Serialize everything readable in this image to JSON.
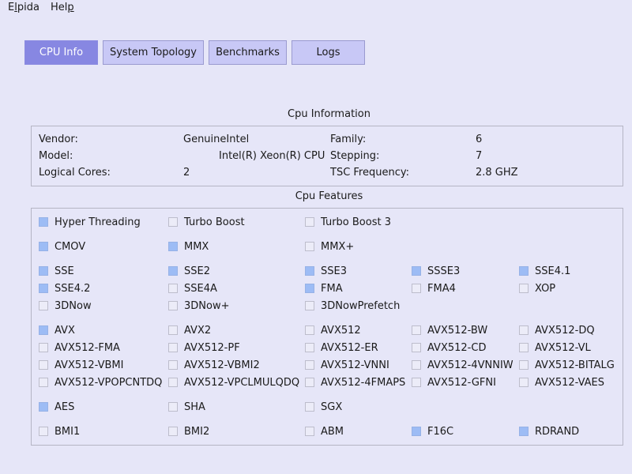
{
  "menu": {
    "app": {
      "before": "E",
      "mnemonic": "l",
      "after": "pida"
    },
    "help": {
      "before": "Hel",
      "mnemonic": "p",
      "after": ""
    }
  },
  "tabs": [
    {
      "label": "CPU Info",
      "active": true
    },
    {
      "label": "System Topology",
      "active": false
    },
    {
      "label": "Benchmarks",
      "active": false
    },
    {
      "label": "Logs",
      "active": false
    }
  ],
  "cpu_info": {
    "title": "Cpu Information",
    "vendor_label": "Vendor:",
    "vendor_value": "GenuineIntel",
    "model_label": "Model:",
    "model_value": "Intel(R) Xeon(R) CPU",
    "logical_cores_label": "Logical Cores:",
    "logical_cores_value": "2",
    "family_label": "Family:",
    "family_value": "6",
    "stepping_label": "Stepping:",
    "stepping_value": "7",
    "tsc_label": "TSC Frequency:",
    "tsc_value": "2.8 GHZ"
  },
  "features": {
    "title": "Cpu Features",
    "rows": [
      [
        {
          "name": "Hyper Threading",
          "checked": true
        },
        {
          "name": "Turbo Boost",
          "checked": false
        },
        {
          "name": "Turbo Boost 3",
          "checked": false
        }
      ],
      [
        {
          "name": "CMOV",
          "checked": true
        },
        {
          "name": "MMX",
          "checked": true
        },
        {
          "name": "MMX+",
          "checked": false
        }
      ],
      [
        {
          "name": "SSE",
          "checked": true
        },
        {
          "name": "SSE2",
          "checked": true
        },
        {
          "name": "SSE3",
          "checked": true
        },
        {
          "name": "SSSE3",
          "checked": true
        },
        {
          "name": "SSE4.1",
          "checked": true
        }
      ],
      [
        {
          "name": "SSE4.2",
          "checked": true
        },
        {
          "name": "SSE4A",
          "checked": false
        },
        {
          "name": "FMA",
          "checked": true
        },
        {
          "name": "FMA4",
          "checked": false
        },
        {
          "name": "XOP",
          "checked": false
        }
      ],
      [
        {
          "name": "3DNow",
          "checked": false
        },
        {
          "name": "3DNow+",
          "checked": false
        },
        {
          "name": "3DNowPrefetch",
          "checked": false
        }
      ],
      [
        {
          "name": "AVX",
          "checked": true
        },
        {
          "name": "AVX2",
          "checked": false
        },
        {
          "name": "AVX512",
          "checked": false
        },
        {
          "name": "AVX512-BW",
          "checked": false
        },
        {
          "name": "AVX512-DQ",
          "checked": false
        }
      ],
      [
        {
          "name": "AVX512-FMA",
          "checked": false
        },
        {
          "name": "AVX512-PF",
          "checked": false
        },
        {
          "name": "AVX512-ER",
          "checked": false
        },
        {
          "name": "AVX512-CD",
          "checked": false
        },
        {
          "name": "AVX512-VL",
          "checked": false
        }
      ],
      [
        {
          "name": "AVX512-VBMI",
          "checked": false
        },
        {
          "name": "AVX512-VBMI2",
          "checked": false
        },
        {
          "name": "AVX512-VNNI",
          "checked": false
        },
        {
          "name": "AVX512-4VNNIW",
          "checked": false
        },
        {
          "name": "AVX512-BITALG",
          "checked": false
        }
      ],
      [
        {
          "name": "AVX512-VPOPCNTDQ",
          "checked": false
        },
        {
          "name": "AVX512-VPCLMULQDQ",
          "checked": false
        },
        {
          "name": "AVX512-4FMAPS",
          "checked": false
        },
        {
          "name": "AVX512-GFNI",
          "checked": false
        },
        {
          "name": "AVX512-VAES",
          "checked": false
        }
      ],
      [
        {
          "name": "AES",
          "checked": true
        },
        {
          "name": "SHA",
          "checked": false
        },
        {
          "name": "SGX",
          "checked": false
        }
      ],
      [
        {
          "name": "BMI1",
          "checked": false
        },
        {
          "name": "BMI2",
          "checked": false
        },
        {
          "name": "ABM",
          "checked": false
        },
        {
          "name": "F16C",
          "checked": true
        },
        {
          "name": "RDRAND",
          "checked": true
        }
      ]
    ]
  },
  "colors": {
    "background": "#e6e6f8",
    "tab": "#c8c8f6",
    "tab_active": "#8787e2",
    "checkbox_on": "#9dbcf5",
    "checkbox_off": "#ececf8"
  }
}
